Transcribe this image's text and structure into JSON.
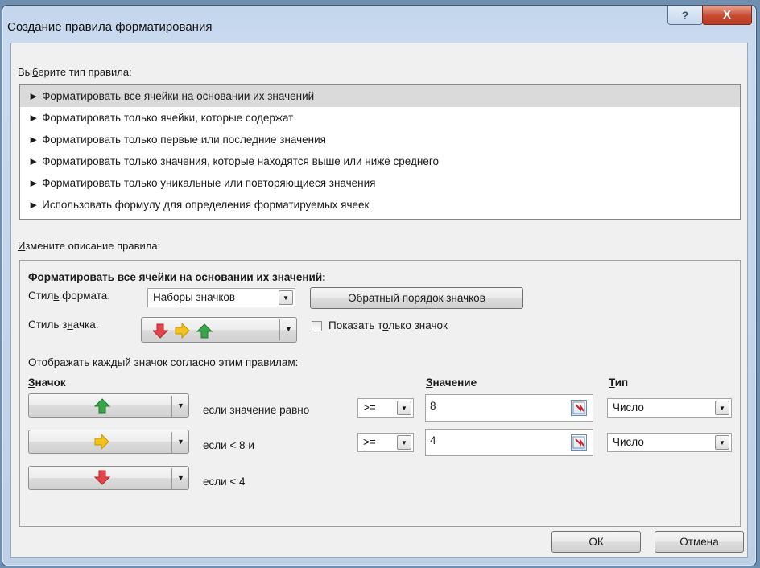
{
  "window": {
    "title": "Создание правила форматирования",
    "help_label": "?",
    "close_label": "X"
  },
  "rule_types": {
    "label_pre": "Вы",
    "label_hot": "б",
    "label_post": "ерите тип правила:",
    "items": [
      "► Форматировать все ячейки на основании их значений",
      "► Форматировать только ячейки, которые содержат",
      "► Форматировать только первые или последние значения",
      "► Форматировать только значения, которые находятся выше или ниже среднего",
      "► Форматировать только уникальные или повторяющиеся значения",
      "► Использовать формулу для определения форматируемых ячеек"
    ],
    "selected_index": 0
  },
  "description": {
    "label_hot": "И",
    "label_post": "змените описание правила:",
    "heading": "Форматировать все ячейки на основании их значений:",
    "format_style_pre": "Стил",
    "format_style_hot": "ь",
    "format_style_post": " формата:",
    "format_style_value": "Наборы значков",
    "reverse_pre": "О",
    "reverse_hot": "б",
    "reverse_post": "ратный порядок значков",
    "icon_style_pre": "Стиль з",
    "icon_style_hot": "н",
    "icon_style_post": "ачка:",
    "show_icon_only_pre": "Показать т",
    "show_icon_only_hot": "о",
    "show_icon_only_post": "лько значок",
    "display_rule_text": "Отображать каждый значок согласно этим правилам:",
    "col_icon_hot": "З",
    "col_icon_post": "начок",
    "col_value_hot": "З",
    "col_value_post": "начение",
    "col_type_hot": "Т",
    "col_type_post": "ип"
  },
  "rules": [
    {
      "icon": "up-arrow-green",
      "condition": "если значение равно",
      "operator": ">=",
      "value": "8",
      "type": "Число"
    },
    {
      "icon": "right-arrow-yellow",
      "condition": "если < 8 и",
      "operator": ">=",
      "value": "4",
      "type": "Число"
    },
    {
      "icon": "down-arrow-red",
      "condition": "если < 4"
    }
  ],
  "buttons": {
    "ok": "ОК",
    "cancel": "Отмена"
  },
  "colors": {
    "up": "#3aa44a",
    "right": "#f3c21f",
    "down": "#e2454a",
    "selection": "#dadada"
  }
}
